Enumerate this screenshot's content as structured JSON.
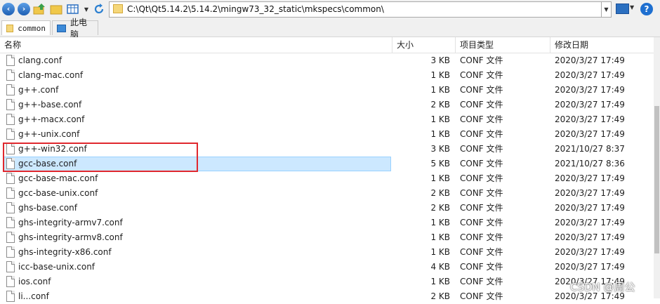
{
  "toolbar": {
    "address": "C:\\Qt\\Qt5.14.2\\5.14.2\\mingw73_32_static\\mkspecs\\common\\",
    "help_label": "?"
  },
  "tabs": [
    {
      "label": "common"
    },
    {
      "label": "此电脑"
    }
  ],
  "columns": {
    "name": "名称",
    "size": "大小",
    "type": "项目类型",
    "date": "修改日期"
  },
  "files": [
    {
      "name": "clang.conf",
      "size": "3 KB",
      "type": "CONF 文件",
      "date": "2020/3/27 17:49"
    },
    {
      "name": "clang-mac.conf",
      "size": "1 KB",
      "type": "CONF 文件",
      "date": "2020/3/27 17:49"
    },
    {
      "name": "g++.conf",
      "size": "1 KB",
      "type": "CONF 文件",
      "date": "2020/3/27 17:49"
    },
    {
      "name": "g++-base.conf",
      "size": "2 KB",
      "type": "CONF 文件",
      "date": "2020/3/27 17:49"
    },
    {
      "name": "g++-macx.conf",
      "size": "1 KB",
      "type": "CONF 文件",
      "date": "2020/3/27 17:49"
    },
    {
      "name": "g++-unix.conf",
      "size": "1 KB",
      "type": "CONF 文件",
      "date": "2020/3/27 17:49"
    },
    {
      "name": "g++-win32.conf",
      "size": "3 KB",
      "type": "CONF 文件",
      "date": "2021/10/27 8:37"
    },
    {
      "name": "gcc-base.conf",
      "size": "5 KB",
      "type": "CONF 文件",
      "date": "2021/10/27 8:36"
    },
    {
      "name": "gcc-base-mac.conf",
      "size": "1 KB",
      "type": "CONF 文件",
      "date": "2020/3/27 17:49"
    },
    {
      "name": "gcc-base-unix.conf",
      "size": "2 KB",
      "type": "CONF 文件",
      "date": "2020/3/27 17:49"
    },
    {
      "name": "ghs-base.conf",
      "size": "2 KB",
      "type": "CONF 文件",
      "date": "2020/3/27 17:49"
    },
    {
      "name": "ghs-integrity-armv7.conf",
      "size": "1 KB",
      "type": "CONF 文件",
      "date": "2020/3/27 17:49"
    },
    {
      "name": "ghs-integrity-armv8.conf",
      "size": "1 KB",
      "type": "CONF 文件",
      "date": "2020/3/27 17:49"
    },
    {
      "name": "ghs-integrity-x86.conf",
      "size": "1 KB",
      "type": "CONF 文件",
      "date": "2020/3/27 17:49"
    },
    {
      "name": "icc-base-unix.conf",
      "size": "4 KB",
      "type": "CONF 文件",
      "date": "2020/3/27 17:49"
    },
    {
      "name": "ios.conf",
      "size": "1 KB",
      "type": "CONF 文件",
      "date": "2020/3/27 17:49"
    },
    {
      "name": "li...conf",
      "size": "2 KB",
      "type": "CONF 文件",
      "date": "2020/3/27 17:49"
    }
  ],
  "selected_file": "gcc-base.conf",
  "watermark": "CSDN @周公",
  "colors": {
    "selection": "#cce8ff",
    "highlight_box": "#e0282e"
  }
}
